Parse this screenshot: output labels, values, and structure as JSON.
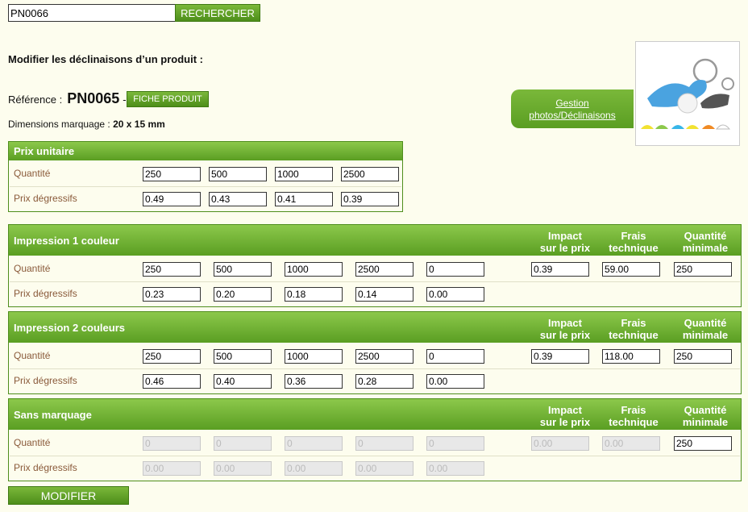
{
  "search": {
    "value": "PN0066",
    "button": "RECHERCHER"
  },
  "heading": "Modifier les déclinaisons d’un produit :",
  "reference": {
    "label": "Référence :",
    "value": "PN0065",
    "dash": "-",
    "fiche_button": "FICHE PRODUIT"
  },
  "dimensions": {
    "label": "Dimensions marquage :",
    "value": "20 x 15 mm"
  },
  "gestion": {
    "line1": "Gestion",
    "line2": "photos/Déclinaisons"
  },
  "row_labels": {
    "quantity": "Quantité",
    "prices": "Prix dégressifs"
  },
  "column_headers": {
    "impact": [
      "Impact",
      "sur le prix"
    ],
    "frais": [
      "Frais",
      "technique"
    ],
    "minimum": [
      "Quantité",
      "minimale"
    ]
  },
  "prix_unitaire": {
    "title": "Prix unitaire",
    "quantities": [
      "250",
      "500",
      "1000",
      "2500"
    ],
    "prices": [
      "0.49",
      "0.43",
      "0.41",
      "0.39"
    ]
  },
  "impression_1": {
    "title": "Impression 1 couleur",
    "quantities": [
      "250",
      "500",
      "1000",
      "2500",
      "0"
    ],
    "prices": [
      "0.23",
      "0.20",
      "0.18",
      "0.14",
      "0.00"
    ],
    "impact": "0.39",
    "frais": "59.00",
    "minimum": "250"
  },
  "impression_2": {
    "title": "Impression 2 couleurs",
    "quantities": [
      "250",
      "500",
      "1000",
      "2500",
      "0"
    ],
    "prices": [
      "0.46",
      "0.40",
      "0.36",
      "0.28",
      "0.00"
    ],
    "impact": "0.39",
    "frais": "118.00",
    "minimum": "250"
  },
  "sans_marquage": {
    "title": "Sans marquage",
    "quantities": [
      "0",
      "0",
      "0",
      "0",
      "0"
    ],
    "prices": [
      "0.00",
      "0.00",
      "0.00",
      "0.00",
      "0.00"
    ],
    "impact": "0.00",
    "frais": "0.00",
    "minimum": "250"
  },
  "submit_button": "MODIFIER",
  "colors": {
    "green_dark": "#4d8e1a",
    "green_light": "#8cc84b",
    "background": "#fdfdee",
    "label_brown": "#8a5a3a"
  }
}
